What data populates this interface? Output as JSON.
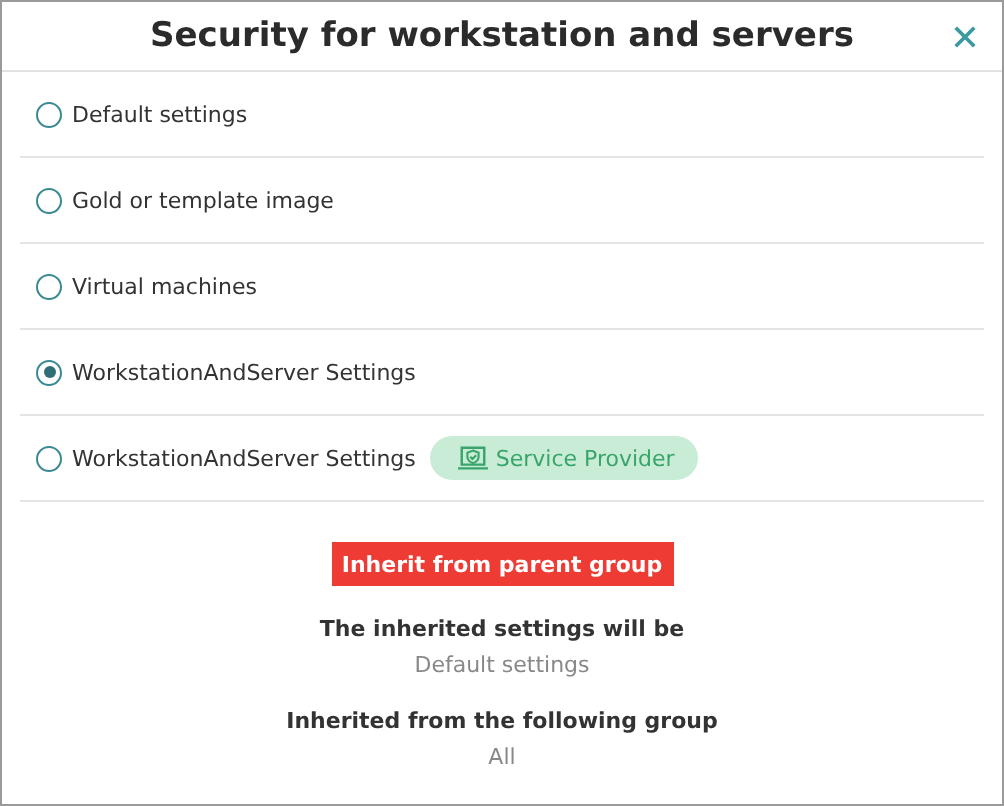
{
  "window": {
    "title": "Security for workstation and servers"
  },
  "options": [
    {
      "label": "Default settings",
      "selected": false
    },
    {
      "label": "Gold or template image",
      "selected": false
    },
    {
      "label": "Virtual machines",
      "selected": false
    },
    {
      "label": "WorkstationAndServer Settings",
      "selected": true
    },
    {
      "label": "WorkstationAndServer Settings",
      "selected": false,
      "badge": "Service Provider"
    }
  ],
  "inherit_button": "Inherit from parent group",
  "info": [
    {
      "heading": "The inherited settings will be",
      "value": "Default settings"
    },
    {
      "heading": "Inherited from the following group",
      "value": "All"
    }
  ]
}
